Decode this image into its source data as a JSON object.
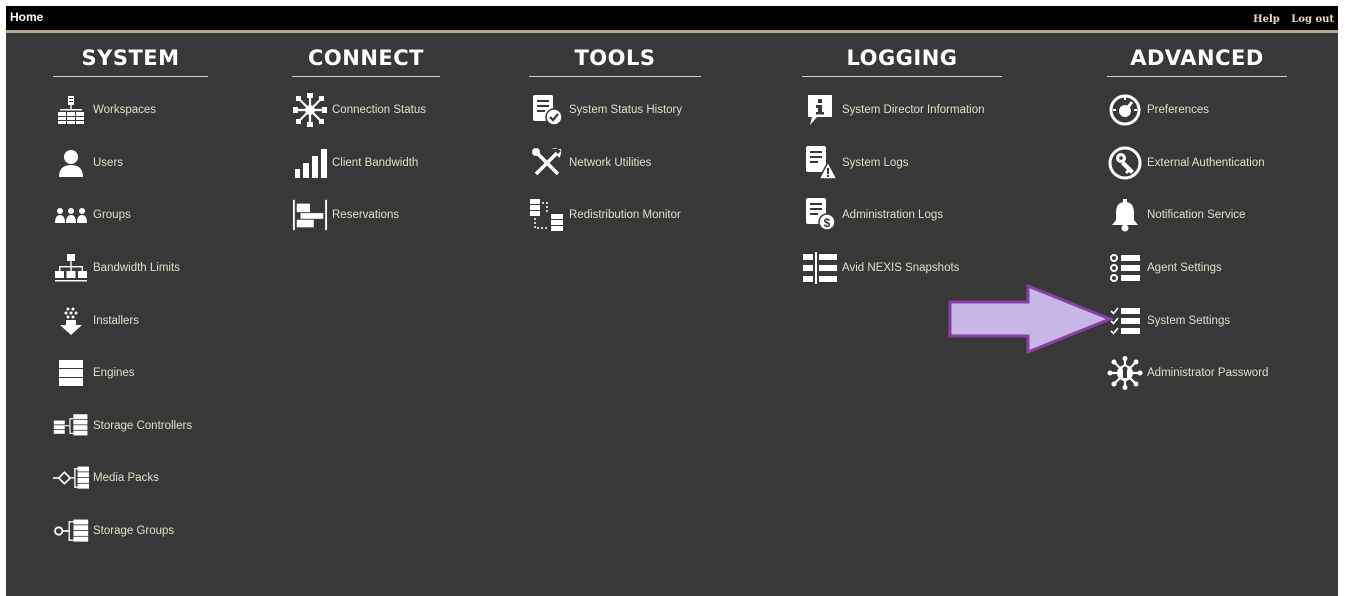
{
  "header": {
    "title": "Home",
    "help_label": "Help",
    "logout_label": "Log out"
  },
  "columns": [
    {
      "heading": "SYSTEM",
      "items": [
        {
          "label": "Workspaces",
          "icon": "workspaces-icon"
        },
        {
          "label": "Users",
          "icon": "user-icon"
        },
        {
          "label": "Groups",
          "icon": "groups-icon"
        },
        {
          "label": "Bandwidth Limits",
          "icon": "bandwidth-limits-icon"
        },
        {
          "label": "Installers",
          "icon": "installers-icon"
        },
        {
          "label": "Engines",
          "icon": "engines-icon"
        },
        {
          "label": "Storage Controllers",
          "icon": "storage-controllers-icon"
        },
        {
          "label": "Media Packs",
          "icon": "media-packs-icon"
        },
        {
          "label": "Storage Groups",
          "icon": "storage-groups-icon"
        }
      ]
    },
    {
      "heading": "CONNECT",
      "items": [
        {
          "label": "Connection Status",
          "icon": "connection-status-icon"
        },
        {
          "label": "Client Bandwidth",
          "icon": "client-bandwidth-icon"
        },
        {
          "label": "Reservations",
          "icon": "reservations-icon"
        }
      ]
    },
    {
      "heading": "TOOLS",
      "items": [
        {
          "label": "System Status History",
          "icon": "status-history-icon"
        },
        {
          "label": "Network Utilities",
          "icon": "network-utilities-icon"
        },
        {
          "label": "Redistribution Monitor",
          "icon": "redistribution-monitor-icon"
        }
      ]
    },
    {
      "heading": "LOGGING",
      "items": [
        {
          "label": "System Director Information",
          "icon": "info-icon"
        },
        {
          "label": "System Logs",
          "icon": "system-logs-icon"
        },
        {
          "label": "Administration Logs",
          "icon": "administration-logs-icon"
        },
        {
          "label": "Avid NEXIS Snapshots",
          "icon": "snapshots-icon"
        }
      ]
    },
    {
      "heading": "ADVANCED",
      "items": [
        {
          "label": "Preferences",
          "icon": "preferences-icon"
        },
        {
          "label": "External Authentication",
          "icon": "external-authentication-icon"
        },
        {
          "label": "Notification Service",
          "icon": "notification-bell-icon"
        },
        {
          "label": "Agent Settings",
          "icon": "agent-settings-icon"
        },
        {
          "label": "System Settings",
          "icon": "system-settings-icon"
        },
        {
          "label": "Administrator Password",
          "icon": "administrator-password-icon"
        }
      ]
    }
  ],
  "colors": {
    "background": "#383838",
    "topbar": "#000000",
    "accent_line": "#b9a58a",
    "label_text": "#e6dccb",
    "arrow_fill": "#c8b6e6",
    "arrow_stroke": "#8a3fa6"
  }
}
